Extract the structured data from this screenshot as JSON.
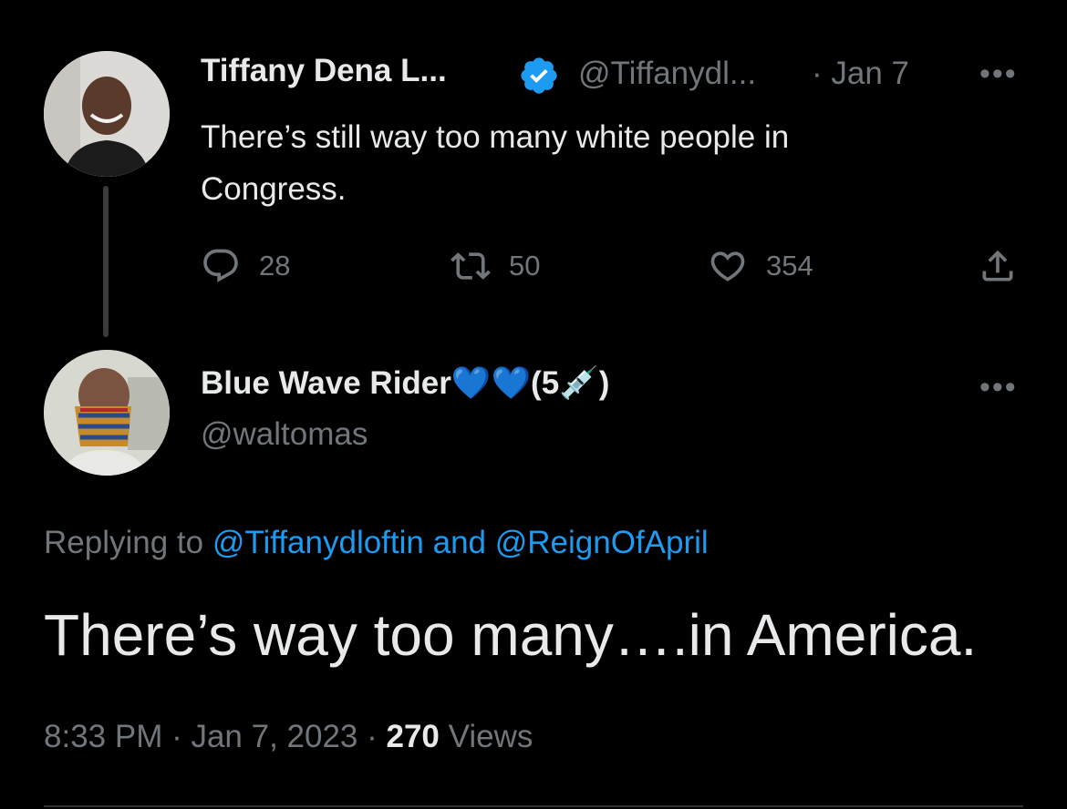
{
  "parent_tweet": {
    "display_name": "Tiffany Dena L...",
    "handle": "@Tiffanydl...",
    "date": "· Jan 7",
    "text": "There’s still way too many white people in Congress.",
    "replies": "28",
    "retweets": "50",
    "likes": "354"
  },
  "reply_tweet": {
    "display_name": "Blue Wave Rider💙💙(5💉)",
    "handle": "@waltomas",
    "replying_prefix": "Replying to",
    "mention_1": "@Tiffanydloftin",
    "and_text": "and",
    "mention_2": "@ReignOfApril",
    "text": "There’s way too many….in America.",
    "time": "8:33 PM · Jan 7, 2023 ·",
    "views_count": "270",
    "views_label": "Views"
  },
  "colors": {
    "background": "#000000",
    "accent": "#1d9bf0",
    "muted": "#71767b",
    "text": "#e7e9ea"
  },
  "icons": [
    "verified-badge-icon",
    "more-icon",
    "reply-icon",
    "retweet-icon",
    "like-icon",
    "share-icon"
  ]
}
